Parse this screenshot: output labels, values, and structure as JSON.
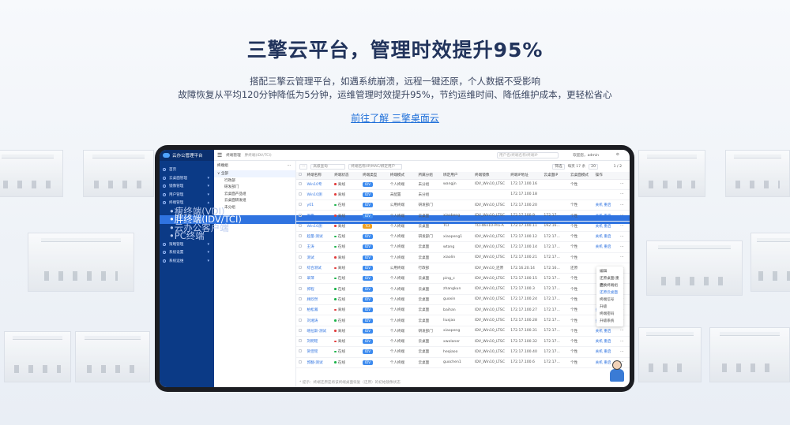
{
  "hero": {
    "title": "三擎云平台，管理时效提升95%",
    "line1": "搭配三擎云管理平台，如遇系统崩溃，远程一键还原，个人数据不受影响",
    "line2": "故障恢复从平均120分钟降低为5分钟，运维管理时效提升95%，节约运维时间、降低维护成本，更轻松省心",
    "link": "前往了解 三擎桌面云"
  },
  "app": {
    "logo": "云办公管理平台",
    "menu": [
      {
        "label": "首页",
        "icon": "home-icon"
      },
      {
        "label": "云桌面管理",
        "icon": "desktop-icon",
        "chev": "▾"
      },
      {
        "label": "镜像管理",
        "icon": "image-icon",
        "chev": "▾"
      },
      {
        "label": "用户管理",
        "icon": "user-icon",
        "chev": "▾"
      },
      {
        "label": "终端管理",
        "icon": "terminal-icon",
        "chev": "▴"
      },
      {
        "label": "瘦终端(VDI)",
        "sub": true
      },
      {
        "label": "胖终端(IDV/TCI)",
        "sub": true,
        "active": true
      },
      {
        "label": "云办公客户端",
        "sub": true
      },
      {
        "label": "PC终端",
        "sub": true
      },
      {
        "label": "策略管理",
        "icon": "policy-icon",
        "chev": "▾"
      },
      {
        "label": "系统设置",
        "icon": "gear-icon",
        "chev": "▾"
      },
      {
        "label": "系统运维",
        "icon": "tools-icon",
        "chev": "▾"
      }
    ],
    "topbar": {
      "menu_icon": "☰",
      "crumb1": "终端管理",
      "crumb2": "胖终端(IDV/TCI)",
      "search_placeholder": "用户名/终端名称/终端IP",
      "user": "欢迎您，admin",
      "gear": "⚙"
    },
    "tree": {
      "header": "终端组",
      "dots": "···",
      "nodes": [
        {
          "label": "全部",
          "root": true
        },
        {
          "label": "行政部",
          "c": true
        },
        {
          "label": "研发部门",
          "c": true
        },
        {
          "label": "云桌面产品组",
          "c": true
        },
        {
          "label": "云桌面研发组",
          "c": true
        },
        {
          "label": "未分组",
          "c": true
        }
      ]
    },
    "toolbar": {
      "more": "···",
      "filter": "高级查询",
      "search": "终端名称/IP/MAC/绑定用户",
      "group": "筛选",
      "page_size_label": "每页 17 条",
      "page_size": "20",
      "pager": "1 / 2"
    },
    "columns": [
      "",
      "终端名称",
      "终端状态",
      "终端类型",
      "终端模式",
      "所属分组",
      "绑定用户",
      "终端镜像",
      "终端IP地址",
      "云桌面IP",
      "云桌面模式",
      "操作",
      ""
    ],
    "rows": [
      [
        "Win10专",
        "离线",
        "red",
        "IDV",
        "个人终端",
        "未分组",
        "wangjn",
        "IDV_Win10_LTSC",
        "172.17.100.16",
        "",
        "个性",
        "",
        "···"
      ],
      [
        "Win10测",
        "离线",
        "red",
        "IDV",
        "未配置",
        "未分组",
        "",
        "",
        "172.17.100.18",
        "",
        "",
        "",
        "···"
      ],
      [
        "y01",
        "在线",
        "green",
        "IDV",
        "公用终端",
        "研发部门",
        "",
        "IDV_Win10_LTSC",
        "172.17.100.20",
        "",
        "个性",
        "关机 重启",
        "···"
      ],
      [
        "图像",
        "离线",
        "red",
        "IDV",
        "个人终端",
        "云桌面",
        "xiaobeng",
        "IDV_Win10_LTSC",
        "172.17.100.9",
        "172.17...",
        "个性",
        "关机 重启",
        "···"
      ],
      [
        "Win10测",
        "离线",
        "red",
        "TCI",
        "个人终端",
        "云桌面",
        "TCI",
        "TCI-Win10-Pro-A",
        "172.17.100.11",
        "192.16...",
        "个性",
        "关机 重启",
        "···"
      ],
      [
        "超量-测试",
        "在线",
        "green",
        "IDV",
        "个人终端",
        "研发部门",
        "xiaopeng1",
        "IDV_Win10_LTSC",
        "172.17.100.12",
        "172.17...",
        "个性",
        "关机 重启",
        "···"
      ],
      [
        "王涛",
        "在线",
        "green",
        "IDV",
        "个人终端",
        "云桌面",
        "wtang",
        "IDV_Win10_LTSC",
        "172.17.100.14",
        "172.17...",
        "个性",
        "关机 重启",
        "···"
      ],
      [
        "测试",
        "离线",
        "red",
        "IDV",
        "个人终端",
        "云桌面",
        "xiaolin",
        "IDV_Win10_LTSC",
        "172.17.100.21",
        "172.17...",
        "个性",
        "",
        "···"
      ],
      [
        "综合测试",
        "离线",
        "red",
        "IDV",
        "公用终端",
        "行政部",
        "",
        "IDV_Win10_还原",
        "172.16.20.14",
        "172.16...",
        "还原",
        "",
        "···"
      ],
      [
        "翠萍",
        "在线",
        "green",
        "IDV",
        "个人终端",
        "云桌面",
        "ping_c",
        "IDV_Win10_LTSC",
        "172.17.100.15",
        "172.17...",
        "个性",
        "",
        "···"
      ],
      [
        "郭程",
        "在线",
        "green",
        "IDV",
        "个人终端",
        "云桌面",
        "zhangkun",
        "IDV_Win10_LTSC",
        "172.17.100.3",
        "172.17...",
        "个性",
        "",
        "···"
      ],
      [
        "顾欣然",
        "在线",
        "green",
        "IDV",
        "个人终端",
        "云桌面",
        "guoxin",
        "IDV_Win10_LTSC",
        "172.17.100.24",
        "172.17...",
        "个性",
        "",
        "···"
      ],
      [
        "柏松瀚",
        "离线",
        "red",
        "IDV",
        "个人终端",
        "云桌面",
        "baihan",
        "IDV_Win10_LTSC",
        "172.17.100.27",
        "172.17...",
        "个性",
        "关机 重启",
        "···"
      ],
      [
        "刘湘涛",
        "在线",
        "green",
        "IDV",
        "个人终端",
        "云桌面",
        "liuxjao",
        "IDV_Win10_LTSC",
        "172.17.100.28",
        "172.17...",
        "个性",
        "关机 重启",
        "···"
      ],
      [
        "喀拉斯-测试",
        "离线",
        "red",
        "IDV",
        "个人终端",
        "研发部门",
        "xiaopeng",
        "IDV_Win10_LTSC",
        "172.17.100.31",
        "172.17...",
        "个性",
        "关机 重启",
        "···"
      ],
      [
        "刘明瑶",
        "离线",
        "red",
        "IDV",
        "个人终端",
        "云桌面",
        "xwolaner",
        "IDV_Win10_LTSC",
        "172.17.100.32",
        "172.17...",
        "个性",
        "关机 重启",
        "···"
      ],
      [
        "贺佳瑶",
        "在线",
        "green",
        "IDV",
        "个人终端",
        "云桌面",
        "heqiaoo",
        "IDV_Win10_LTSC",
        "172.17.100.40",
        "172.17...",
        "个性",
        "关机 重启",
        "···"
      ],
      [
        "郭翻-测试",
        "在线",
        "green",
        "IDV",
        "个人终端",
        "云桌面",
        "guochen1",
        "IDV_Win10_LTSC",
        "172.17.100.6",
        "172.17...",
        "个性",
        "关机 重启",
        "···"
      ]
    ],
    "dropdown": [
      "编辑",
      "还原桌面(重启)",
      "更换终端组",
      "还原云桌面",
      "终端信号",
      "升级",
      "终端密码",
      "升级系统"
    ],
    "footer": "* 提示：终端还原是将该终端桌面恢复（还原）的初始镜像状态",
    "colors": {
      "sidebar": "#0b3a86",
      "active": "#2f73e0",
      "online": "#1bb34a",
      "offline": "#e23c3c",
      "idv": "#3d8bef",
      "tci": "#f0a020"
    }
  }
}
